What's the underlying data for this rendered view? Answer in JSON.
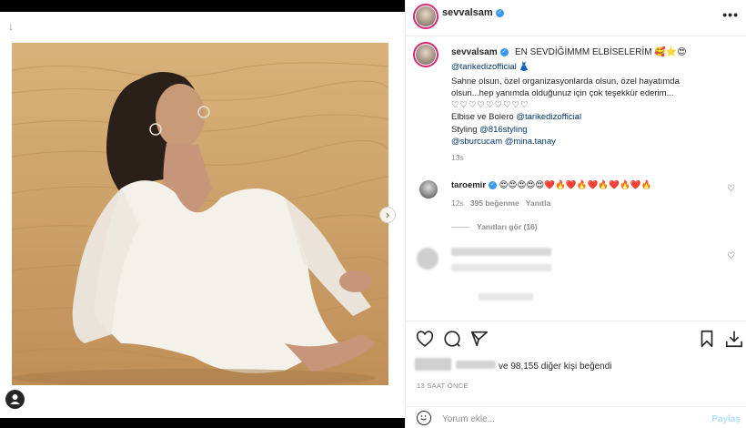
{
  "header": {
    "username": "sevvalsam",
    "more_label": "•••"
  },
  "caption": {
    "username": "sevvalsam",
    "title": "EN SEVDİĞİMMM ELBİSELERİM 🥰⭐😍",
    "tag1": "@tarikedizofficial 👗",
    "text1": "Sahne olsun, özel organizasyonlarda olsun, özel hayatımda",
    "text2": "olsun...hep yanımda olduğunuz için çok teşekkür ederim...",
    "hearts": "♡♡♡♡♡♡♡♡♡",
    "dress_prefix": "Elbise ve Bolero ",
    "dress_tag": "@tarikedizofficial",
    "styling_prefix": "Styling ",
    "styling_tag": "@816styling",
    "tag_a": "@sburcucam",
    "tag_b": "@mina.tanay",
    "time": "13s"
  },
  "comment1": {
    "username": "taroemir",
    "emojis": "😍😍😍😍😍❤️🔥❤️🔥❤️🔥❤️🔥❤️🔥",
    "time": "12s",
    "likes": "395 beğenme",
    "reply": "Yanıtla",
    "view_replies": "Yanıtları gör (16)"
  },
  "likes": {
    "text": "ve 98,155 diğer kişi beğendi",
    "time": "13 SAAT ÖNCE"
  },
  "comment_box": {
    "placeholder": "Yorum ekle...",
    "post": "Paylaş"
  }
}
